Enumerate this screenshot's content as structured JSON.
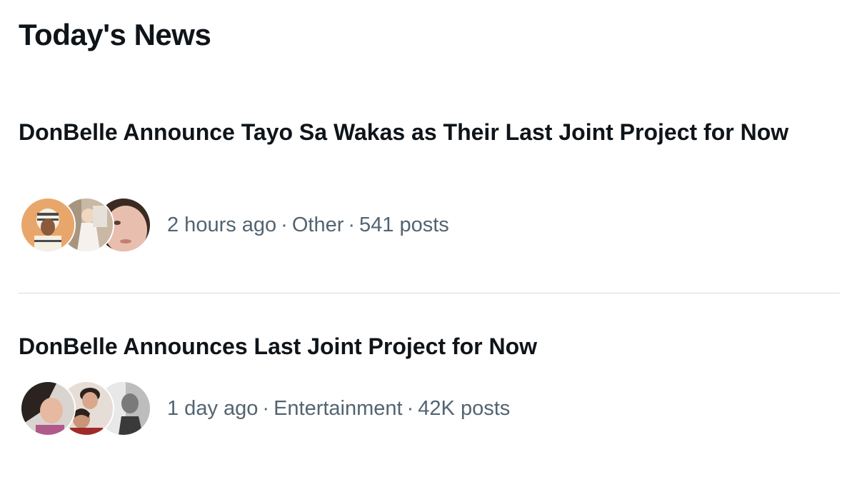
{
  "section": {
    "title": "Today's News"
  },
  "news": [
    {
      "headline": "DonBelle Announce Tayo Sa Wakas as Their Last Joint Project for Now",
      "time": "2 hours ago",
      "separator": "·",
      "category": "Other",
      "posts": "541 posts"
    },
    {
      "headline": "DonBelle Announces Last Joint Project for Now",
      "time": "1 day ago",
      "separator": "·",
      "category": "Entertainment",
      "posts": "42K posts"
    }
  ]
}
